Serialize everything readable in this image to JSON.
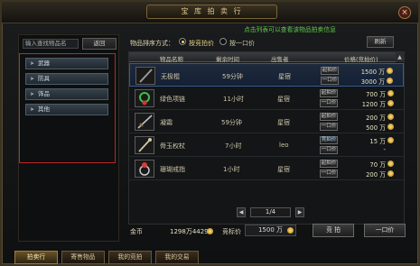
{
  "window": {
    "title": "宝 库 拍 卖 行",
    "close_label": "×"
  },
  "left_panel": {
    "search_placeholder": "输入查找物品名",
    "search_button": "返回",
    "categories": [
      {
        "label": "武器"
      },
      {
        "label": "防具"
      },
      {
        "label": "饰品"
      },
      {
        "label": "其他"
      }
    ]
  },
  "sort_bar": {
    "label": "物品排序方式：",
    "options": [
      {
        "label": "按竞拍价",
        "selected": true
      },
      {
        "label": "按一口价",
        "selected": false
      }
    ],
    "refresh_label": "刷新"
  },
  "hint_text": "点击列表可以查看该物品拍卖信息",
  "table": {
    "headers": [
      "物品名称",
      "剩余时间",
      "出售者",
      "价格(竞拍价)"
    ],
    "scroll_up": "▲",
    "rows": [
      {
        "name": "无极棍",
        "time": "59分钟",
        "seller": "星宿",
        "buttons": [
          "起拍价",
          "一口价"
        ],
        "prices": [
          "1500 万",
          "3000 万"
        ],
        "icon": "staff-icon",
        "icon_color": "#9a9a9a",
        "selected": true
      },
      {
        "name": "绿色项链",
        "time": "11小时",
        "seller": "星宿",
        "buttons": [
          "起拍价",
          "一口价"
        ],
        "prices": [
          "700 万",
          "1200 万"
        ],
        "icon": "necklace-icon",
        "icon_color": "#3fbf4a",
        "selected": false
      },
      {
        "name": "凝霜",
        "time": "59分钟",
        "seller": "星宿",
        "buttons": [
          "起拍价",
          "一口价"
        ],
        "prices": [
          "200 万",
          "500 万"
        ],
        "icon": "sword-icon",
        "icon_color": "#b9c3c7",
        "selected": false
      },
      {
        "name": "骨玉权杖",
        "time": "7小时",
        "seller": "leo",
        "buttons": [
          "竞拍价",
          "一口价"
        ],
        "prices": [
          "15 万",
          "-"
        ],
        "icon": "scepter-icon",
        "icon_color": "#d0c9a6",
        "selected": false
      },
      {
        "name": "珊瑚戒指",
        "time": "1小时",
        "seller": "星宿",
        "buttons": [
          "起拍价",
          "一口价"
        ],
        "prices": [
          "70 万",
          "200 万"
        ],
        "icon": "ring-icon",
        "icon_color": "#d63c3c",
        "selected": false
      }
    ],
    "pager": {
      "text": "1/4",
      "prev": "◀",
      "next": "▶"
    }
  },
  "bottom": {
    "gold_label": "金币",
    "gold_value": "1298万4429",
    "bid_label": "竞标价",
    "bid_value": "1500 万",
    "bid_button": "竞 拍",
    "buyout_button": "一口价"
  },
  "tabs": [
    {
      "label": "拍卖行",
      "active": true
    },
    {
      "label": "寄售物品",
      "active": false
    },
    {
      "label": "我的竞拍",
      "active": false
    },
    {
      "label": "我的交易",
      "active": false
    }
  ]
}
